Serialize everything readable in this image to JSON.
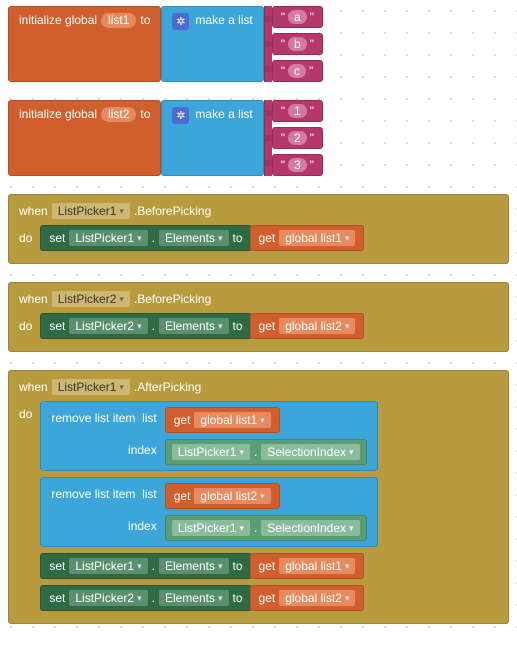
{
  "init": {
    "label_prefix": "initialize global",
    "label_to": "to",
    "make_list": "make a list",
    "vars": [
      {
        "name": "list1",
        "items": [
          "a",
          "b",
          "c"
        ]
      },
      {
        "name": "list2",
        "items": [
          "1",
          "2",
          "3"
        ]
      }
    ]
  },
  "events": {
    "when": "when",
    "do": "do",
    "set": "set",
    "to": "to",
    "get": "get",
    "elements": "Elements",
    "beforePicking": ".BeforePicking",
    "afterPicking": ".AfterPicking",
    "removeItem": "remove list item",
    "list_lbl": "list",
    "index_lbl": "index",
    "selectionIndex": "SelectionIndex",
    "picker1": "ListPicker1",
    "picker2": "ListPicker2",
    "gl1": "global list1",
    "gl2": "global list2"
  }
}
